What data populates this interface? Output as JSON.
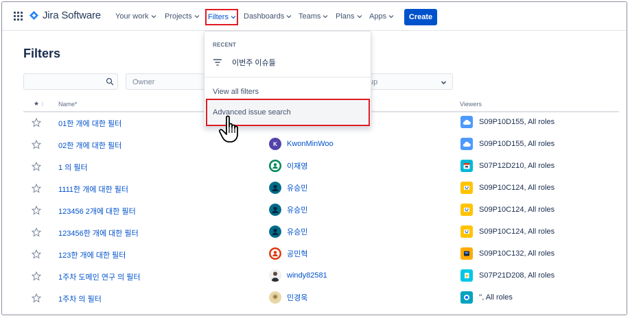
{
  "nav": {
    "product": "Jira Software",
    "items": [
      {
        "label": "Your work"
      },
      {
        "label": "Projects"
      },
      {
        "label": "Filters"
      },
      {
        "label": "Dashboards"
      },
      {
        "label": "Teams"
      },
      {
        "label": "Plans"
      },
      {
        "label": "Apps"
      }
    ],
    "create_label": "Create",
    "icons": {
      "app_switcher": "grid-icon",
      "logo": "jira-diamond-icon",
      "chevron": "chevron-down-icon"
    }
  },
  "page": {
    "title": "Filters",
    "search": {
      "placeholder": "",
      "icon": "search-icon"
    },
    "owner_filter": {
      "placeholder": "Owner"
    },
    "group_filter": {
      "partial_placeholder": "up",
      "icon": "chevron-down-icon"
    }
  },
  "table": {
    "headers": {
      "star": "★",
      "name": "Name",
      "name_sort": "*",
      "viewers": "Viewers"
    },
    "rows": [
      {
        "name": "01한 개에 대한 필터",
        "owner": "",
        "owner_avatar": "purple",
        "viewers": "S09P10D155, All roles",
        "viewer_icon": "cloud-icon"
      },
      {
        "name": "02한 개에 대한 필터",
        "owner": "KwonMinWoo",
        "owner_avatar": "K",
        "viewers": "S09P10D155, All roles",
        "viewer_icon": "cloud-icon"
      },
      {
        "name": "1 의 필터",
        "owner": "이재영",
        "owner_avatar": "teal-person",
        "viewers": "S07P12D210, All roles",
        "viewer_icon": "calendar-icon"
      },
      {
        "name": "1111한 개에 대한 필터",
        "owner": "유승민",
        "owner_avatar": "blue-person",
        "viewers": "S09P10C124, All roles",
        "viewer_icon": "yellow-project-icon"
      },
      {
        "name": "123456 2개에 대한 필터",
        "owner": "유승민",
        "owner_avatar": "blue-person",
        "viewers": "S09P10C124, All roles",
        "viewer_icon": "yellow-project-icon"
      },
      {
        "name": "123456한 개에 대한 필터",
        "owner": "유승민",
        "owner_avatar": "blue-person",
        "viewers": "S09P10C124, All roles",
        "viewer_icon": "yellow-project-icon"
      },
      {
        "name": "123한 개에 대한 필터",
        "owner": "공민혁",
        "owner_avatar": "orange-person",
        "viewers": "S09P10C132, All roles",
        "viewer_icon": "dark-project-icon"
      },
      {
        "name": "1주차 도메인 연구 의 필터",
        "owner": "windy82581",
        "owner_avatar": "photo",
        "viewers": "S07P21D208, All roles",
        "viewer_icon": "teal-project-icon"
      },
      {
        "name": "1주차 의 필터",
        "owner": "민경욱",
        "owner_avatar": "photo-round",
        "viewers": "'', All roles",
        "viewer_icon": "globe-project-icon"
      }
    ]
  },
  "dropdown": {
    "section": "RECENT",
    "recent_item": "이번주 이슈들",
    "view_all": "View all filters",
    "advanced": "Advanced issue search"
  },
  "colors": {
    "brand": "#0052cc",
    "highlight": "#e01a22",
    "text": "#172b4d",
    "muted": "#5e6c84"
  }
}
